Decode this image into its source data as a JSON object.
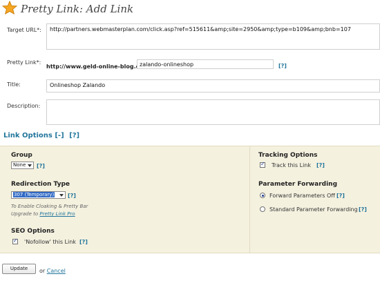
{
  "header": {
    "title": "Pretty Link: Add Link",
    "icon": "star-icon"
  },
  "form": {
    "target_url_label": "Target URL*:",
    "target_url_value": "http://partners.webmasterplan.com/click.asp?ref=515611&amp;site=2950&amp;type=b109&amp;bnb=107",
    "pretty_link_label": "Pretty Link*:",
    "pretty_link_prefix": "http://www.geld-online-blog.de/",
    "pretty_link_slug": "zalando-onlineshop",
    "title_label": "Title:",
    "title_value": "Onlineshop Zalando",
    "description_label": "Description:",
    "description_value": "",
    "help": "[?]"
  },
  "link_options": {
    "heading": "Link Options",
    "toggle": "[-]",
    "help": "[?]",
    "group": {
      "heading": "Group",
      "selected": "None"
    },
    "redirection": {
      "heading": "Redirection Type",
      "selected": "307 (Temporary)",
      "note_line1": "To Enable Cloaking & Pretty Bar",
      "note_line2_prefix": "Upgrade to ",
      "note_link": "Pretty Link Pro"
    },
    "seo": {
      "heading": "SEO Options",
      "nofollow_label": "'Nofollow' this Link",
      "nofollow_checked": true
    },
    "tracking": {
      "heading": "Tracking Options",
      "track_label": "Track this Link",
      "track_checked": true
    },
    "forwarding": {
      "heading": "Parameter Forwarding",
      "options": [
        {
          "label": "Forward Parameters Off",
          "selected": true
        },
        {
          "label": "Standard Parameter Forwarding",
          "selected": false
        }
      ]
    }
  },
  "actions": {
    "update_label": "Update",
    "or_text": "or",
    "cancel_label": "Cancel"
  },
  "colors": {
    "link": "#21759b",
    "panel_bg": "#f4f1df",
    "star": "#f5a623"
  }
}
